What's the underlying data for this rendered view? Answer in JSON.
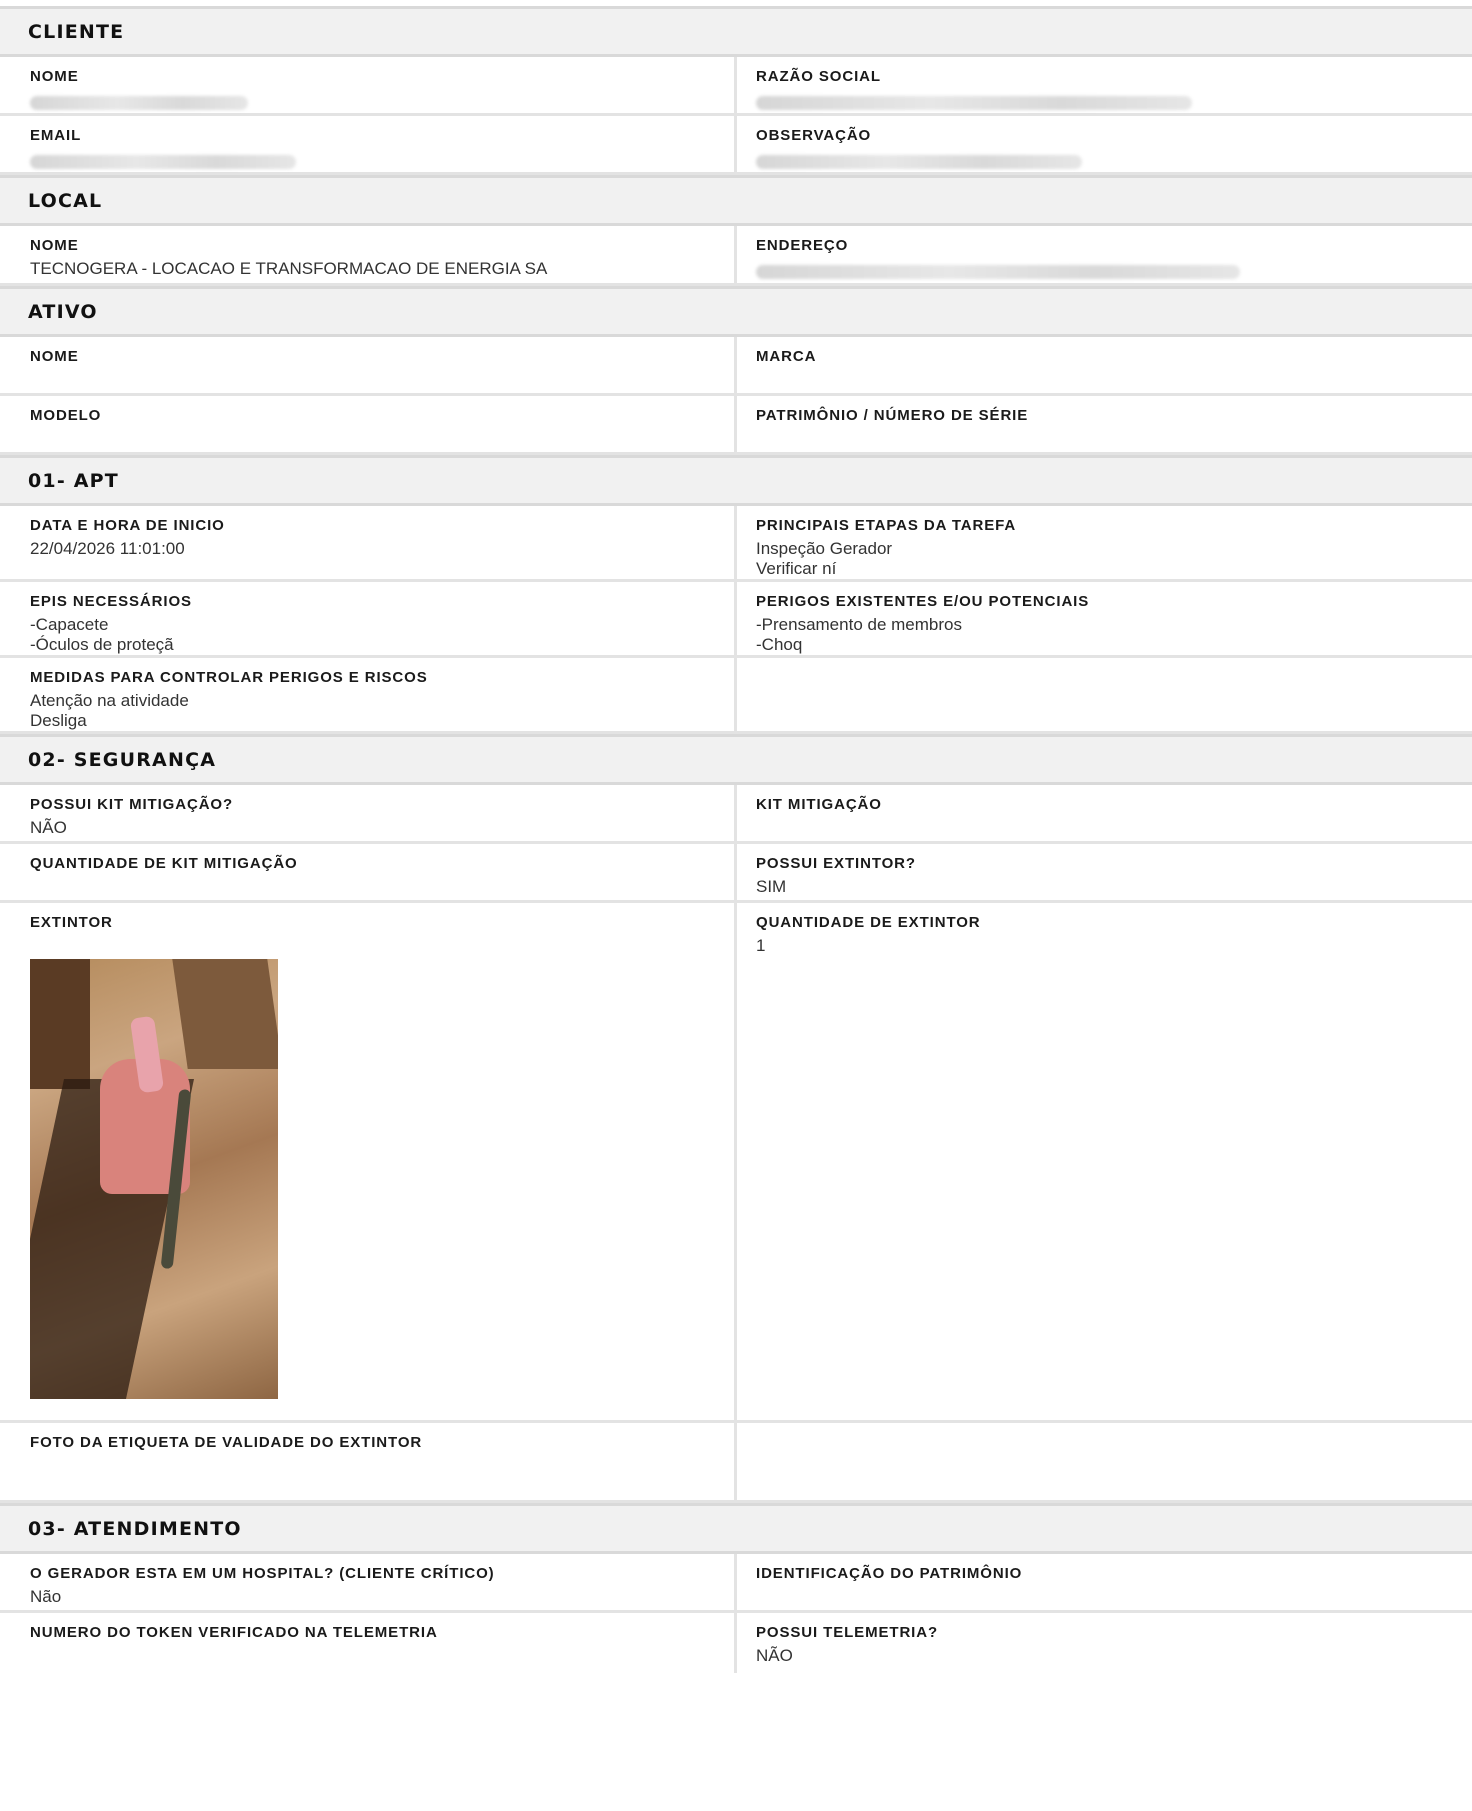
{
  "cliente": {
    "header": "CLIENTE",
    "nome_label": "NOME",
    "razao_social_label": "RAZÃO SOCIAL",
    "email_label": "EMAIL",
    "observacao_label": "OBSERVAÇÃO"
  },
  "local": {
    "header": "LOCAL",
    "nome_label": "NOME",
    "nome_value": "TECNOGERA - LOCACAO E TRANSFORMACAO DE ENERGIA SA",
    "endereco_label": "ENDEREÇO"
  },
  "ativo": {
    "header": "ATIVO",
    "nome_label": "NOME",
    "marca_label": "MARCA",
    "modelo_label": "MODELO",
    "patrimonio_label": "PATRIMÔNIO / NÚMERO DE SÉRIE"
  },
  "apt": {
    "header": "01- APT",
    "data_label": "DATA E HORA DE INICIO",
    "data_value": "22/04/2026 11:01:00",
    "etapas_label": "PRINCIPAIS ETAPAS DA TAREFA",
    "etapas_value": "Inspeção Gerador\nVerificar ní",
    "epis_label": "EPIS NECESSÁRIOS",
    "epis_value": "-Capacete\n-Óculos de proteçã",
    "perigos_label": "PERIGOS EXISTENTES E/OU POTENCIAIS",
    "perigos_value": "-Prensamento de membros\n-Choq",
    "medidas_label": "MEDIDAS PARA CONTROLAR PERIGOS E RISCOS",
    "medidas_value": "Atenção na atividade\nDesliga"
  },
  "seguranca": {
    "header": "02- SEGURANÇA",
    "possui_kit_label": "POSSUI KIT MITIGAÇÃO?",
    "possui_kit_value": "NÃO",
    "kit_label": "KIT MITIGAÇÃO",
    "qtd_kit_label": "QUANTIDADE DE KIT MITIGAÇÃO",
    "possui_extintor_label": "POSSUI EXTINTOR?",
    "possui_extintor_value": "SIM",
    "extintor_label": "EXTINTOR",
    "qtd_extintor_label": "QUANTIDADE DE EXTINTOR",
    "qtd_extintor_value": "1",
    "foto_etiqueta_label": "FOTO DA ETIQUETA DE VALIDADE DO EXTINTOR"
  },
  "atendimento": {
    "header": "03- ATENDIMENTO",
    "hospital_label": "O GERADOR ESTA EM UM HOSPITAL? (CLIENTE CRÍTICO)",
    "hospital_value": "Não",
    "identificacao_label": "IDENTIFICAÇÃO DO PATRIMÔNIO",
    "token_label": "NUMERO DO TOKEN VERIFICADO NA TELEMETRIA",
    "telemetria_label": "POSSUI TELEMETRIA?",
    "telemetria_value": "NÃO"
  }
}
